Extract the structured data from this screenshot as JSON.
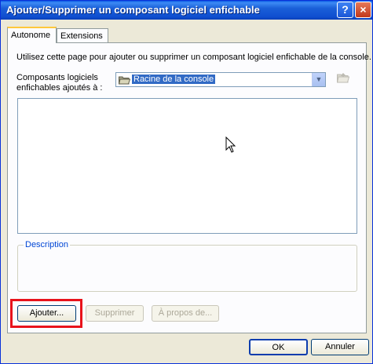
{
  "window": {
    "title": "Ajouter/Supprimer un composant logiciel enfichable"
  },
  "titlebar_buttons": {
    "help": "?",
    "close": "×"
  },
  "tabs": [
    {
      "label": "Autonome",
      "active": true
    },
    {
      "label": "Extensions",
      "active": false
    }
  ],
  "panel": {
    "intro": "Utilisez cette page pour ajouter ou supprimer un composant logiciel enfichable de la console.",
    "combo_label_line1": "Composants logiciels",
    "combo_label_line2": "enfichables ajoutés à :",
    "combo_value": "Racine de la console",
    "description_legend": "Description",
    "add_label": "Ajouter...",
    "remove_label": "Supprimer",
    "about_label": "À propos de..."
  },
  "footer": {
    "ok_label": "OK",
    "cancel_label": "Annuler"
  },
  "colors": {
    "highlight": "#e8131b",
    "title_bar": "#0a58e4",
    "selection": "#316ac5"
  }
}
